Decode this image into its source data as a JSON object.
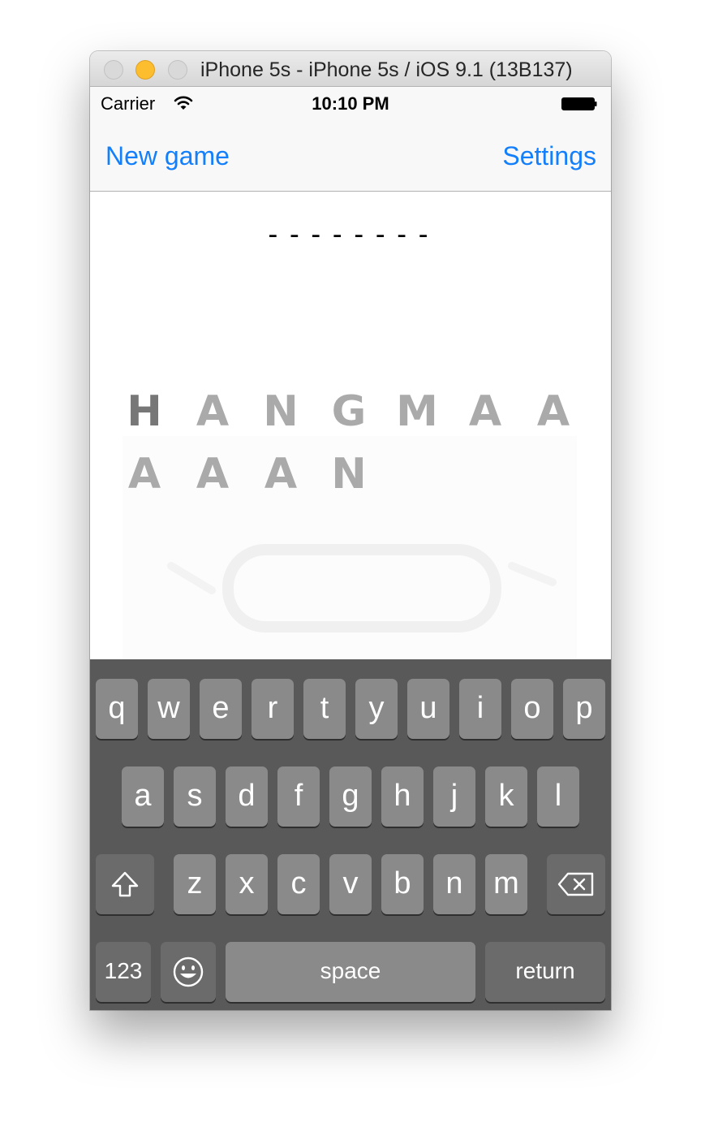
{
  "window": {
    "title": "iPhone 5s - iPhone 5s / iOS 9.1 (13B137)"
  },
  "status": {
    "carrier": "Carrier",
    "time": "10:10 PM"
  },
  "nav": {
    "left_label": "New game",
    "right_label": "Settings"
  },
  "game": {
    "word_mask": "--------",
    "splash_letters_row1": [
      "H",
      "A",
      "N",
      "G",
      "M",
      "A",
      "A"
    ],
    "splash_letters_row2": [
      "A",
      "A",
      "A",
      "N"
    ]
  },
  "keyboard": {
    "row1": [
      "q",
      "w",
      "e",
      "r",
      "t",
      "y",
      "u",
      "i",
      "o",
      "p"
    ],
    "row2": [
      "a",
      "s",
      "d",
      "f",
      "g",
      "h",
      "j",
      "k",
      "l"
    ],
    "row3": [
      "z",
      "x",
      "c",
      "v",
      "b",
      "n",
      "m"
    ],
    "numbers_label": "123",
    "space_label": "space",
    "return_label": "return"
  }
}
